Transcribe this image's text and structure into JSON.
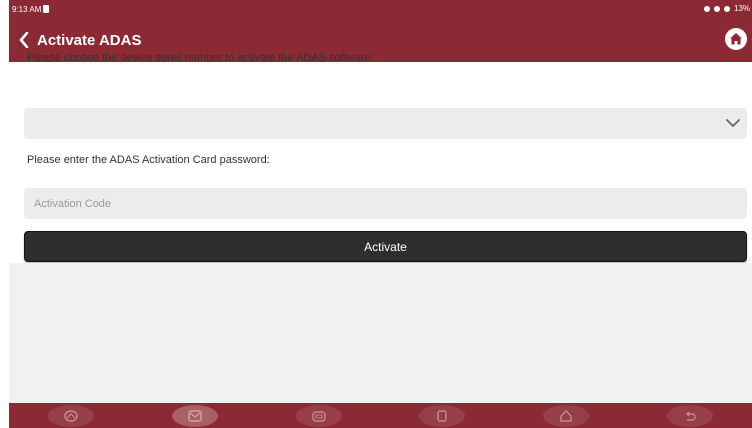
{
  "status_bar": {
    "time": "9:13 AM",
    "battery": "13%"
  },
  "header": {
    "title": "Activate ADAS",
    "back_icon": "chevron-left-icon",
    "home_icon": "home-icon"
  },
  "form": {
    "serial_label": "Please choose the device serial number to activate the ADAS software:",
    "serial_value": "",
    "password_label": "Please enter the ADAS Activation Card password:",
    "code_placeholder": "Activation Code",
    "code_value": "",
    "activate_label": "Activate"
  },
  "nav_bar": {
    "icons": [
      "diagnose-icon",
      "mail-icon",
      "car-icon",
      "recent-apps-icon",
      "home-icon",
      "back-icon"
    ]
  },
  "colors": {
    "header_bg": "#8b2a34",
    "button_bg": "#2e2e2e",
    "field_bg": "#ececec"
  }
}
